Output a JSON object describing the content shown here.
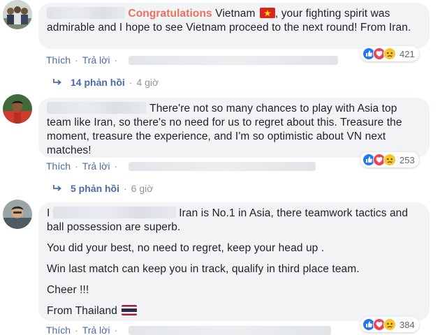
{
  "comments": [
    {
      "highlight": "Congratulations",
      "text_after_highlight": "Vietnam",
      "text_rest": ", your fighting spirit was admirable and I hope to see Vietnam proceed to the next round! From Iran.",
      "like_label": "Thích",
      "reply_label": "Trả lời",
      "reaction_count": "421",
      "replies_label": "14 phản hồi",
      "replies_time": "4 giờ"
    },
    {
      "text": "There're not so many chances to play with Asia top team like Iran, so there's no need for us to regret about this. Treasure the moment, treasure the experience, and I'm so optimistic about VN next matches!",
      "like_label": "Thích",
      "reply_label": "Trả lời",
      "reaction_count": "253",
      "replies_label": "5 phản hồi",
      "replies_time": "6 giờ"
    },
    {
      "prefix": "I",
      "line1": "Iran is No.1 in Asia, there teamwork tactics and ball possession are superb.",
      "line2": "You did your best, no need to regret, keep your head up .",
      "line3": "Win last match can keep you in track, qualify in third place team.",
      "line4": "Cheer !!!",
      "line5": "From Thailand",
      "like_label": "Thích",
      "reply_label": "Trả lời",
      "reaction_count": "384"
    }
  ],
  "reaction_icons": [
    "like-reaction",
    "love-reaction",
    "sad-reaction"
  ],
  "colors": {
    "highlight": "#e8715c",
    "link": "#4b6aa8",
    "bubble": "#f2f3f5",
    "like": "#2078f4",
    "love": "#f33e58",
    "sad": "#f7c62b"
  }
}
